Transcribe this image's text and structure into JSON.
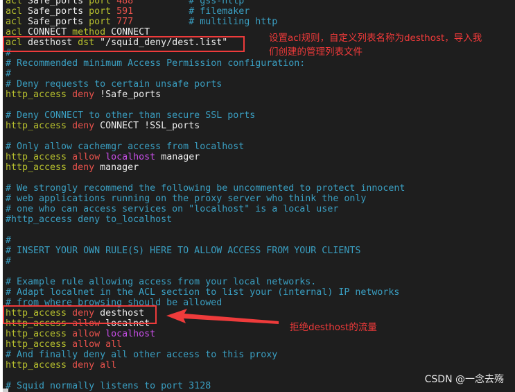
{
  "editor": {
    "lines": [
      [
        [
          "k",
          "acl "
        ],
        [
          "w",
          "Safe_ports "
        ],
        [
          "k",
          "port "
        ],
        [
          "r",
          "488"
        ],
        [
          "c",
          "          # gss-http"
        ]
      ],
      [
        [
          "k",
          "acl "
        ],
        [
          "w",
          "Safe_ports "
        ],
        [
          "k",
          "port "
        ],
        [
          "r",
          "591"
        ],
        [
          "c",
          "          # filemaker"
        ]
      ],
      [
        [
          "k",
          "acl "
        ],
        [
          "w",
          "Safe_ports "
        ],
        [
          "k",
          "port "
        ],
        [
          "r",
          "777"
        ],
        [
          "c",
          "          # multiling http"
        ]
      ],
      [
        [
          "k",
          "acl "
        ],
        [
          "w",
          "CONNECT "
        ],
        [
          "k",
          "method "
        ],
        [
          "w",
          "CONNECT"
        ]
      ],
      [
        [
          "k",
          "acl "
        ],
        [
          "w",
          "desthost "
        ],
        [
          "k",
          "dst "
        ],
        [
          "w",
          "\"/squid_deny/dest.list\""
        ]
      ],
      [
        [
          "c",
          "#"
        ]
      ],
      [
        [
          "c",
          "# Recommended minimum Access Permission configuration:"
        ]
      ],
      [
        [
          "c",
          "#"
        ]
      ],
      [
        [
          "c",
          "# Deny requests to certain unsafe ports"
        ]
      ],
      [
        [
          "k",
          "http_access "
        ],
        [
          "r",
          "deny "
        ],
        [
          "w",
          "!Safe_ports"
        ]
      ],
      [],
      [
        [
          "c",
          "# Deny CONNECT to other than secure SSL ports"
        ]
      ],
      [
        [
          "k",
          "http_access "
        ],
        [
          "r",
          "deny "
        ],
        [
          "w",
          "CONNECT !SSL_ports"
        ]
      ],
      [],
      [
        [
          "c",
          "# Only allow cachemgr access from localhost"
        ]
      ],
      [
        [
          "k",
          "http_access "
        ],
        [
          "r",
          "allow "
        ],
        [
          "m",
          "localhost "
        ],
        [
          "w",
          "manager"
        ]
      ],
      [
        [
          "k",
          "http_access "
        ],
        [
          "r",
          "deny "
        ],
        [
          "w",
          "manager"
        ]
      ],
      [],
      [
        [
          "c",
          "# We strongly recommend the following be uncommented to protect innocent"
        ]
      ],
      [
        [
          "c",
          "# web applications running on the proxy server who think the only"
        ]
      ],
      [
        [
          "c",
          "# one who can access services on \"localhost\" is a local user"
        ]
      ],
      [
        [
          "c",
          "#http_access deny to_localhost"
        ]
      ],
      [],
      [
        [
          "c",
          "#"
        ]
      ],
      [
        [
          "c",
          "# INSERT YOUR OWN RULE(S) HERE TO ALLOW ACCESS FROM YOUR CLIENTS"
        ]
      ],
      [
        [
          "c",
          "#"
        ]
      ],
      [],
      [
        [
          "c",
          "# Example rule allowing access from your local networks."
        ]
      ],
      [
        [
          "c",
          "# Adapt localnet in the ACL section to list your (internal) IP networks"
        ]
      ],
      [
        [
          "c",
          "# from where browsing should be allowed"
        ]
      ],
      [
        [
          "k",
          "http_access "
        ],
        [
          "r",
          "deny "
        ],
        [
          "w",
          "desthost"
        ]
      ],
      [
        [
          "k",
          "http_access "
        ],
        [
          "r",
          "allow "
        ],
        [
          "w",
          "localnet"
        ]
      ],
      [
        [
          "k",
          "http_access "
        ],
        [
          "r",
          "allow "
        ],
        [
          "m",
          "localhost"
        ]
      ],
      [
        [
          "k",
          "http_access "
        ],
        [
          "r",
          "allow "
        ],
        [
          "r",
          "all"
        ]
      ],
      [
        [
          "c",
          "# And finally deny all other access to this proxy"
        ]
      ],
      [
        [
          "k",
          "http_access "
        ],
        [
          "r",
          "deny "
        ],
        [
          "r",
          "all"
        ]
      ],
      [],
      [
        [
          "c",
          "# Squid normally listens to port 3128"
        ]
      ]
    ]
  },
  "annotations": {
    "note1_line1": "设置acl规则，自定义列表名称为desthost，导入我",
    "note1_line2": "们创建的管理列表文件",
    "note2": "拒绝desthost的流量"
  },
  "watermark": "CSDN @一念去殇",
  "colors": {
    "highlight_box": "#ee3b3b",
    "background": "#1e1e1e",
    "keyword": "#b9c22e",
    "comment": "#3a9fc2"
  }
}
